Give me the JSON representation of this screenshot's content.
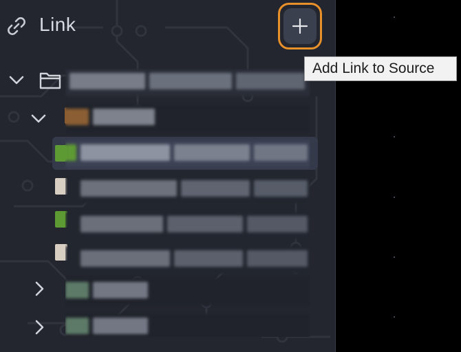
{
  "panel": {
    "title": "Link",
    "add_button_tooltip": "Add Link to Source"
  },
  "icons": {
    "header": "link-icon",
    "add": "plus-icon",
    "folder": "folder-icon",
    "expanded": "chevron-down-icon",
    "collapsed": "chevron-right-icon"
  },
  "colors": {
    "panel_bg": "#23262e",
    "canvas_bg": "#000000",
    "focus_ring": "#e8902a",
    "button_bg": "#3a404e",
    "selected_row": "#343a4a",
    "tooltip_bg": "#f2f2f2"
  },
  "tree": {
    "content_blurred": true
  }
}
